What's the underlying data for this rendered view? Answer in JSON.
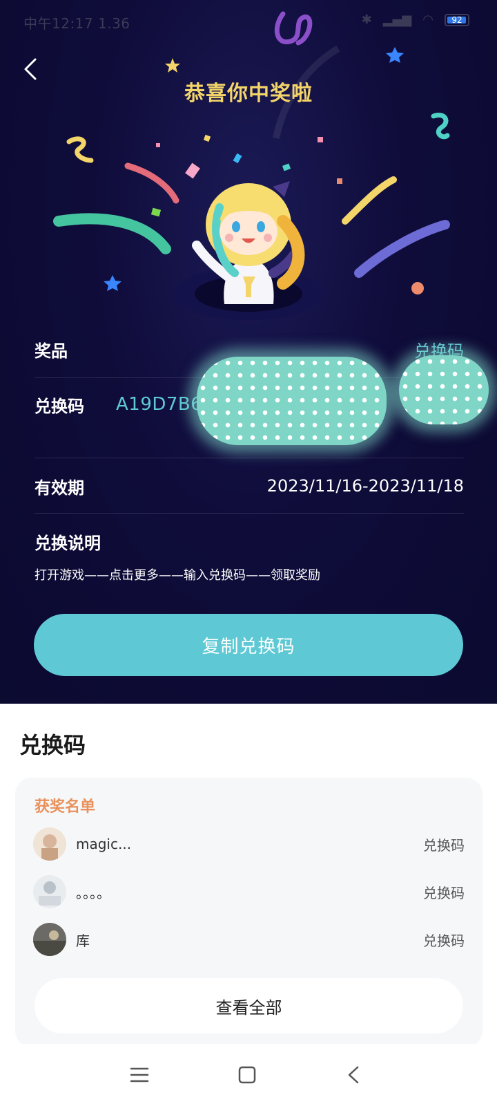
{
  "status_bar": {
    "time_text": "中午12:17 1.36",
    "battery": "92"
  },
  "header": {
    "title": "恭喜你中奖啦"
  },
  "prize": {
    "prize_label": "奖品",
    "prize_value": "兑换码",
    "code_label": "兑换码",
    "code_value_visible": "A19D7B6",
    "validity_label": "有效期",
    "validity_value": "2023/11/16-2023/11/18",
    "instructions_label": "兑换说明",
    "instructions_text": "打开游戏——点击更多——输入兑换码——领取奖励",
    "copy_button": "复制兑换码"
  },
  "winners_section": {
    "title": "兑换码",
    "card_title": "获奖名单",
    "winners": [
      {
        "name": "magic...",
        "prize": "兑换码"
      },
      {
        "name": "。。。。",
        "prize": "兑换码"
      },
      {
        "name": "库",
        "prize": "兑换码"
      }
    ],
    "view_all": "查看全部"
  },
  "colors": {
    "background_dark": "#0f0c3a",
    "title_gold": "#f4d56a",
    "accent_cyan": "#5ec9d4",
    "winners_orange": "#e8915c"
  }
}
